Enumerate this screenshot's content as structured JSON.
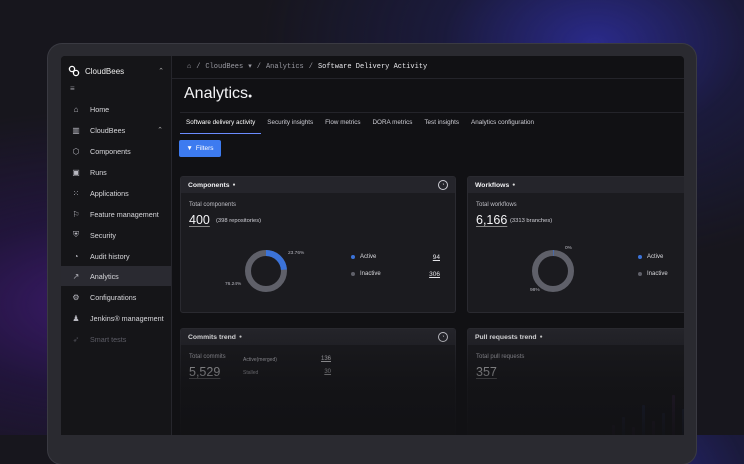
{
  "org": {
    "name": "CloudBees"
  },
  "sidebar": {
    "items": [
      {
        "label": "Home",
        "icon": "home-icon"
      },
      {
        "label": "CloudBees",
        "icon": "building-icon"
      },
      {
        "label": "Components",
        "icon": "cube-icon"
      },
      {
        "label": "Runs",
        "icon": "run-icon"
      },
      {
        "label": "Applications",
        "icon": "grid-icon"
      },
      {
        "label": "Feature management",
        "icon": "flag-icon"
      },
      {
        "label": "Security",
        "icon": "shield-icon"
      },
      {
        "label": "Audit history",
        "icon": "history-icon"
      },
      {
        "label": "Analytics",
        "icon": "analytics-icon"
      },
      {
        "label": "Configurations",
        "icon": "gear-icon"
      },
      {
        "label": "Jenkins® management",
        "icon": "jenkins-icon"
      },
      {
        "label": "Smart tests",
        "icon": "rocket-icon"
      }
    ]
  },
  "breadcrumb": {
    "org": "CloudBees",
    "section": "Analytics",
    "current": "Software Delivery Activity"
  },
  "page": {
    "title": "Analytics"
  },
  "tabs": [
    "Software delivery activity",
    "Security insights",
    "Flow metrics",
    "DORA metrics",
    "Test insights",
    "Analytics configuration"
  ],
  "filters_label": "Filters",
  "components": {
    "title": "Components",
    "total_label": "Total components",
    "total": "400",
    "sub": "(398 repositories)",
    "pct_active": "23.76%",
    "pct_inactive": "76.24%",
    "active_label": "Active",
    "active_value": "94",
    "inactive_label": "Inactive",
    "inactive_value": "306",
    "active_fraction": 0.2376
  },
  "workflows": {
    "title": "Workflows",
    "total_label": "Total workflows",
    "total": "6,166",
    "sub": "(3313 branches)",
    "pct_active": "0%",
    "pct_inactive": "98%",
    "active_label": "Active",
    "inactive_label": "Inactive",
    "active_fraction": 0.0
  },
  "commits": {
    "title": "Commits trend",
    "total_label": "Total commits",
    "total": "5,529",
    "row1_label": "Active(merged)",
    "row1_value": "136",
    "row2_label": "Stalled",
    "row2_value": "30"
  },
  "pulls": {
    "title": "Pull requests trend",
    "total_label": "Total pull requests",
    "total": "357"
  },
  "colors": {
    "accent": "#3d7bf0",
    "active": "#3b73d9",
    "inactive": "#5f6069"
  }
}
